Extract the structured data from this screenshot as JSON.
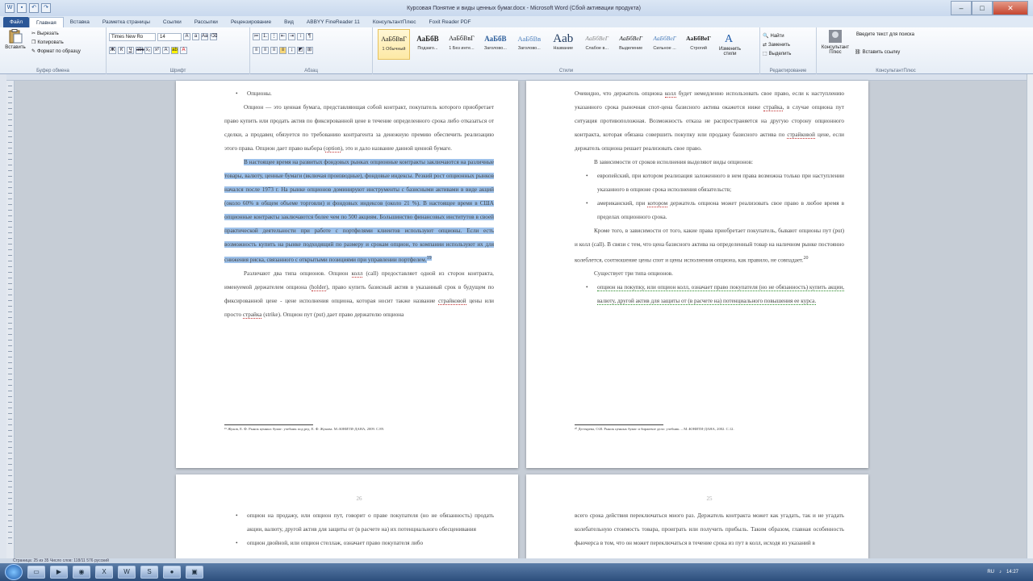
{
  "window": {
    "title": "Курсовая Понятие и виды ценных бумаг.docx - Microsoft Word (Сбой активации продукта)"
  },
  "tabs": [
    "Файл",
    "Главная",
    "Вставка",
    "Разметка страницы",
    "Ссылки",
    "Рассылки",
    "Рецензирование",
    "Вид",
    "ABBYY FineReader 11",
    "КонсультантПлюс",
    "Foxit Reader PDF"
  ],
  "ribbon": {
    "clipboard": {
      "label": "Буфер обмена",
      "paste": "Вставить",
      "cut": "Вырезать",
      "copy": "Копировать",
      "format": "Формат по образцу"
    },
    "font": {
      "label": "Шрифт",
      "name": "Times New Ro",
      "size": "14"
    },
    "paragraph": {
      "label": "Абзац"
    },
    "styles": {
      "label": "Стили",
      "items": [
        {
          "sample": "АаБбВвГ",
          "name": "1 Обычный"
        },
        {
          "sample": "АаБбВ",
          "name": "Подзаго..."
        },
        {
          "sample": "АаБбВвГ",
          "name": "1 Без инте..."
        },
        {
          "sample": "АаБбВ",
          "name": "Заголово..."
        },
        {
          "sample": "АаБбВв",
          "name": "Заголово..."
        },
        {
          "sample": "Aab",
          "name": "Название"
        },
        {
          "sample": "АаБбВеГ",
          "name": "Слабое в..."
        },
        {
          "sample": "АаБбВеГ",
          "name": "Выделение"
        },
        {
          "sample": "АаБбВеГ",
          "name": "Сильное ..."
        },
        {
          "sample": "АаБбВеГ",
          "name": "Строгий"
        }
      ],
      "change": "Изменить стили"
    },
    "editing": {
      "label": "Редактирование",
      "find": "Найти",
      "replace": "Заменить",
      "select": "Выделить"
    },
    "consultant": {
      "label": "КонсультантПлюс",
      "name": "Консультант Плюс",
      "search": "Введите текст для поиска",
      "insert": "Вставить ссылку"
    }
  },
  "pages": {
    "p1": {
      "bullet": "Опционы.",
      "para1": "Опцион — это ценная бумага, представляющая собой контракт, покупатель которого приобретает право купить или продать актив по фиксированной цене в течение определенного срока либо отказаться от сделки, а продавец обязуется по требованию контрагента за денежную премию обеспечить реализацию этого права. Опцион дает право выбора (",
      "para1_link": "option",
      "para1_end": "), это и дало название данной ценной бумаге.",
      "para2_sel": "В настоящее время на развитых фондовых рынках опционные контракты заключаются на различные товары, валюту, ценные бумаги (включая производные), фондовые индексы. Резкий рост опционных рынков начался после 1973 г. На рынке опционов доминируют инструменты с базисными активами в виде акций (около 60% в общем объеме торговли) и фондовых индексов (около 21 %). В настоящее время в США опционные контракты заключаются более чем по 500 акциям. Большинство финансовых институтов в своей практической деятельности при работе с портфелями клиентов используют опционы. Если есть возможность купить на рынке подходящий по размеру и срокам опцион, то компании используют их для снижения риска, связанного с открытыми позициями при управлении портфелем.",
      "para2_sup": "19",
      "para3_a": "Различают два типа опционов. Опцион ",
      "para3_kol": "колл",
      "para3_b": " (call) предоставляет одной из сторон контракта, именуемой держателем опциона (",
      "para3_holder": "holder",
      "para3_c": "), право купить базисный актив в указанный срок в будущем по фиксированной цене - цене исполнения опциона, которая носит также название ",
      "para3_strike": "страйковой",
      "para3_d": " цены или просто ",
      "para3_strike2": "страйка",
      "para3_e": " (strike). Опцион пут (put) дает право держателю опциона",
      "footnote": "¹⁹ Жуков, Е. Ф. Рынок ценных бумаг: учебник под ред. Е. Ф. Жукова. М.:ЮНИТИ-ДАНА, 2009. С.89."
    },
    "p2": {
      "para1_a": "Очевидно, что держатель опциона ",
      "para1_kol": "колл",
      "para1_b": " будет немедленно использовать свое право, если к наступлению указанного срока рыночная спот-цена базисного актива окажется ниже ",
      "para1_strike": "страйка",
      "para1_c": ", в случае опциона пут ситуация противоположная. Возможность отказа не распространяется на другую сторону опционного контракта, которая обязана совершить покупку или продажу базисного актива по ",
      "para1_strike2": "страйковой",
      "para1_d": " цене, если держатель опциона решает реализовать свое право.",
      "para2": "В зависимости от сроков исполнения выделяют виды опционов:",
      "bullet1": "европейский, при котором реализация заложенного в нем права возможна только при наступлении указанного в опционе срока исполнения обязательств;",
      "bullet2_a": "американский, при ",
      "bullet2_link": "котором",
      "bullet2_b": " держатель опциона может реализовать свое право в любое время в пределах опционного срока.",
      "para3": "Кроме того, в зависимости от того, какие права приобретает покупатель, бывают опционы пут (put) и колл (call). В связи с тем, что цена базисного актива на определенный товар на наличном рынке постоянно колеблется, соотношение цены спот и цены исполнения опциона, как правило, не совпадает.",
      "para3_sup": "20",
      "para4": "Существует три типа опционов.",
      "bullet3": "опцион на покупку, или опцион колл, означает право покупателя (но не обязанность) купить акции, валюту, другой актив для защиты от (в расчете на) потенциального повышения ее курса.",
      "footnote": "²⁰ Дегтярева, О.И. Рынок ценных бумаг и биржевое дело: учебник. – М.:ЮНИТИ-ДАНА, 2002. С.12."
    },
    "p3": {
      "num": "26",
      "bullet1": "опцион на продажу, или опцион пут, говорит о праве покупателя (но не обязанность) продать акции, валюту, другой актив для защиты от (в расчете на) их потенциального обесценивания",
      "bullet2": "опцион двойной, или опцион стеллаж, означает право покупателя либо"
    },
    "p4": {
      "num": "25",
      "para1": "всего срока действия переключаться много раз. Держатель контракта может как угадать, так и не угадать колебательную стоимость товара, проиграть или получить прибыль. Таким образом, главная особенность фьючерса в том, что он может переключаться в течение срока из пут в колл, исходя из указаний в"
    }
  },
  "status": {
    "text": "Страница: 25 из 35   Число слов: 118/11 576   русский"
  },
  "taskbar": {
    "lang": "RU",
    "time": "14:27"
  }
}
